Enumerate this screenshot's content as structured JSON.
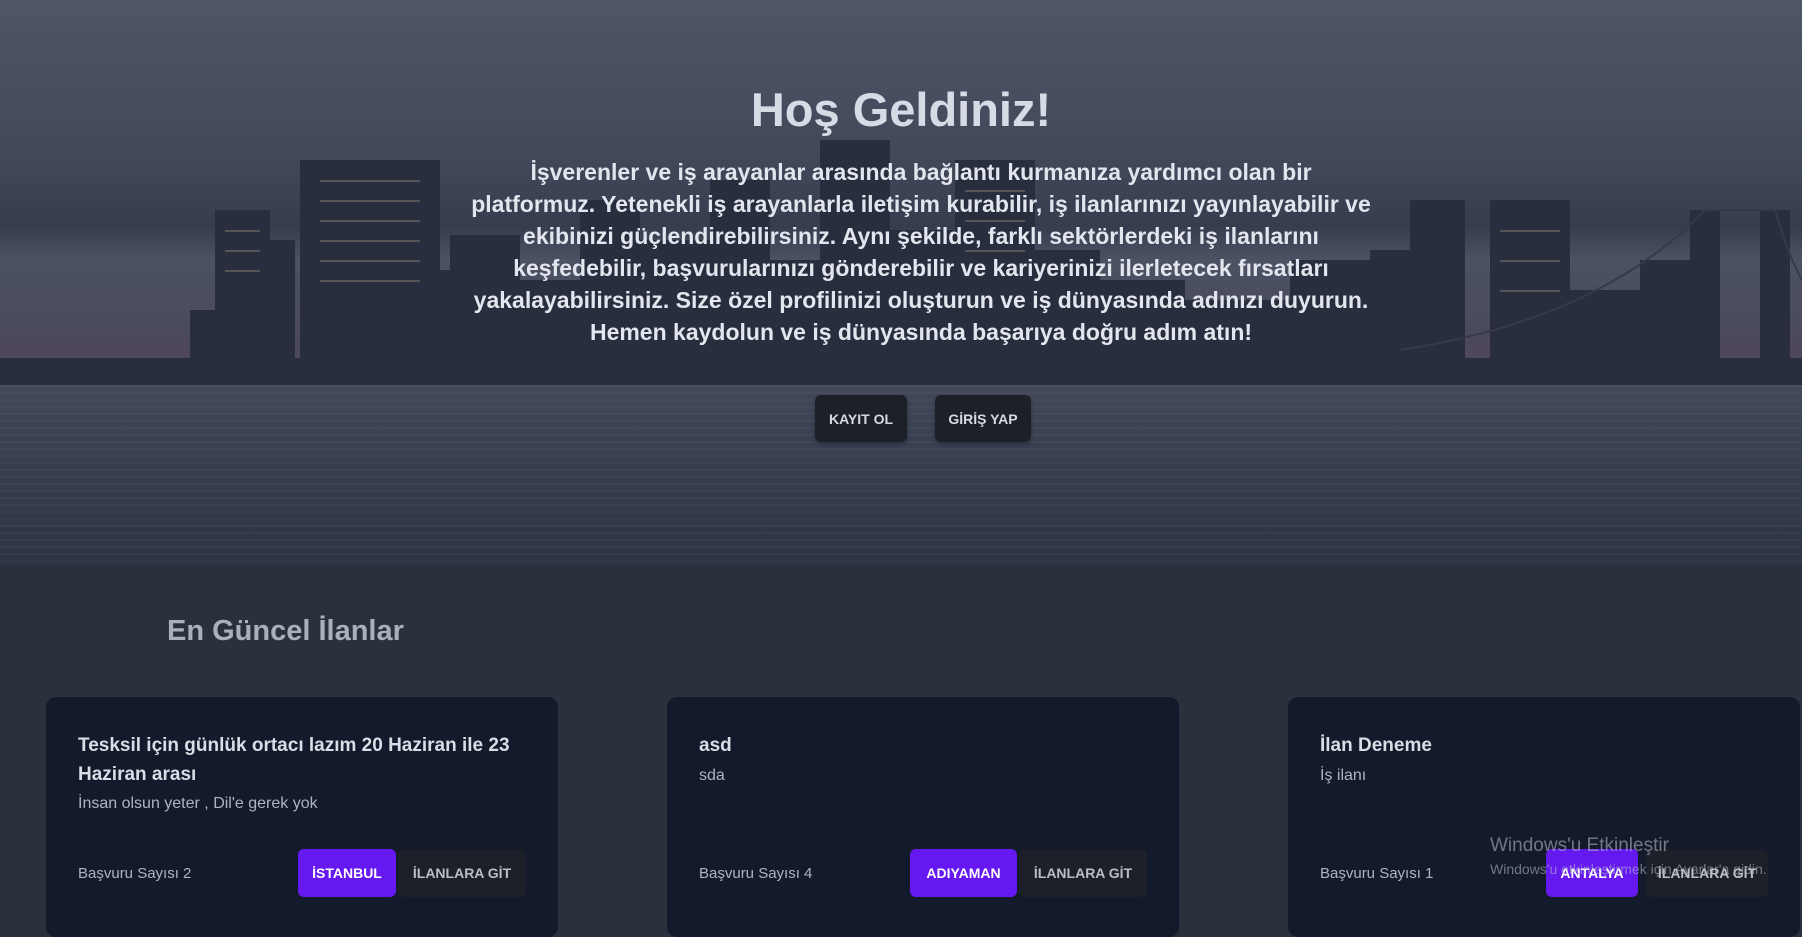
{
  "hero": {
    "title": "Hoş Geldiniz!",
    "description": "İşverenler ve iş arayanlar arasında bağlantı kurmanıza yardımcı olan bir platformuz. Yetenekli iş arayanlarla iletişim kurabilir, iş ilanlarınızı yayınlayabilir ve ekibinizi güçlendirebilirsiniz. Aynı şekilde, farklı sektörlerdeki iş ilanlarını keşfedebilir, başvurularınızı gönderebilir ve kariyerinizi ilerletecek fırsatları yakalayabilirsiniz. Size özel profilinizi oluşturun ve iş dünyasında adınızı duyurun. Hemen kaydolun ve iş dünyasında başarıya doğru adım atın!",
    "register_label": "KAYIT OL",
    "login_label": "GİRİŞ YAP"
  },
  "listings": {
    "title": "En Güncel İlanlar",
    "cards": [
      {
        "title": "Tesksil için günlük ortacı lazım 20 Haziran ile 23 Haziran arası",
        "description": "İnsan olsun yeter , Dil'e gerek yok",
        "count_label": "Başvuru Sayısı 2",
        "city": "İSTANBUL",
        "go_label": "İLANLARA GİT"
      },
      {
        "title": "asd",
        "description": "sda",
        "count_label": "Başvuru Sayısı 4",
        "city": "ADIYAMAN",
        "go_label": "İLANLARA GİT"
      },
      {
        "title": "İlan Deneme",
        "description": "İş ilanı",
        "count_label": "Başvuru Sayısı 1",
        "city": "ANTALYA",
        "go_label": "İLANLARA GİT"
      }
    ]
  },
  "watermark": {
    "line1": "Windows'u Etkinleştir",
    "line2": "Windows'u etkinleştirmek için Ayarlar'a gidin."
  },
  "colors": {
    "accent": "#6518f0",
    "card_bg": "#131a2b",
    "page_bg": "#2b303d"
  }
}
